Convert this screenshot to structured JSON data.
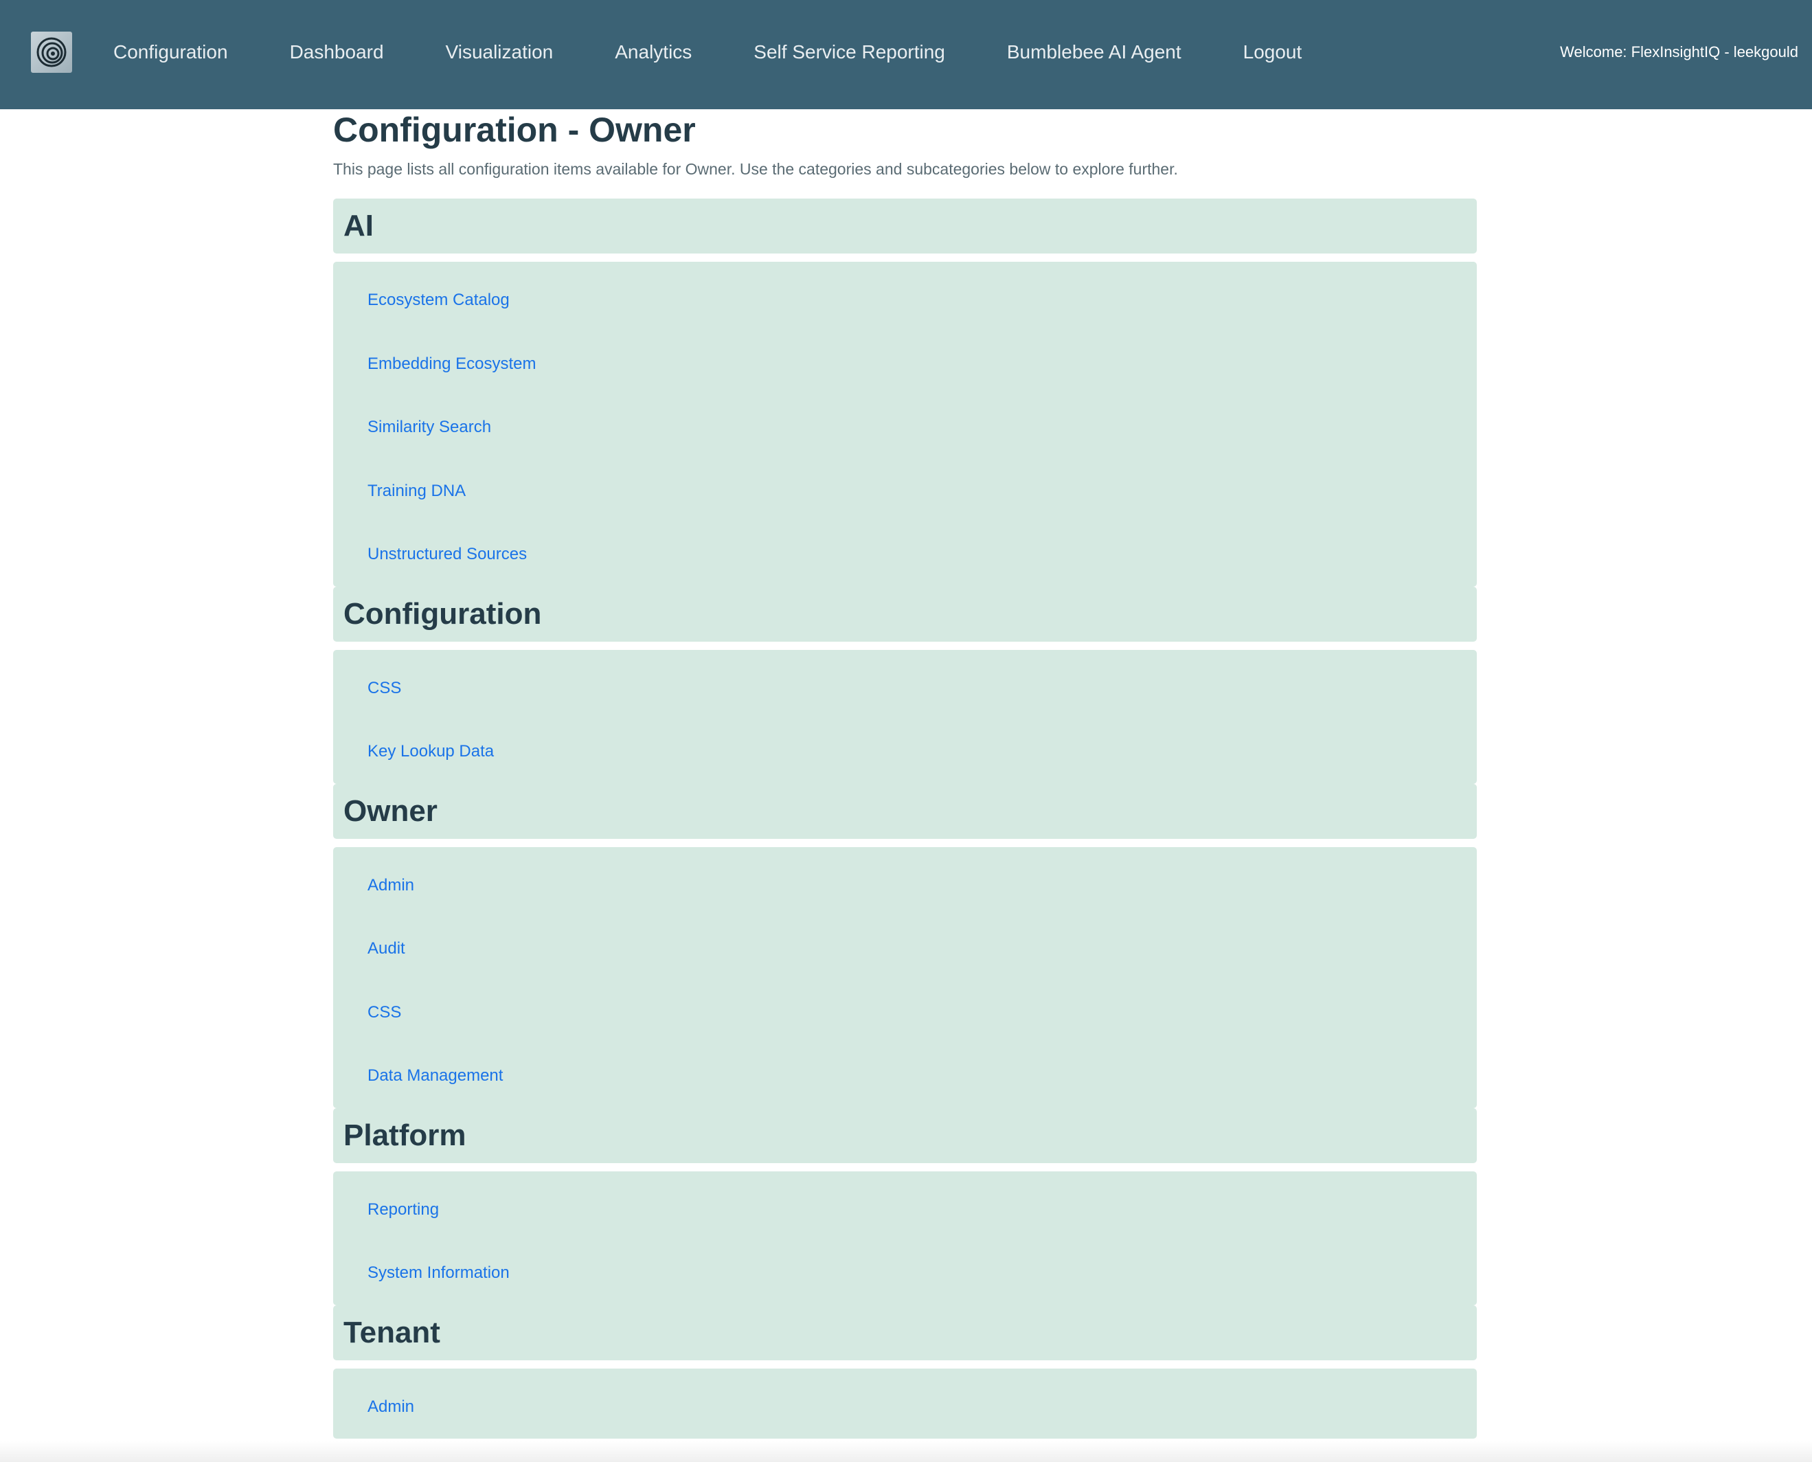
{
  "nav": {
    "links": [
      {
        "label": "Configuration"
      },
      {
        "label": "Dashboard"
      },
      {
        "label": "Visualization"
      },
      {
        "label": "Analytics"
      },
      {
        "label": "Self Service Reporting"
      },
      {
        "label": "Bumblebee AI Agent"
      },
      {
        "label": "Logout"
      }
    ],
    "welcome": "Welcome: FlexInsightIQ - leekgould",
    "logo_icon": "concentric-circles-logo-icon"
  },
  "page": {
    "title": "Configuration - Owner",
    "description": "This page lists all configuration items available for Owner. Use the categories and subcategories below to explore further."
  },
  "categories": [
    {
      "name": "AI",
      "items": [
        "Ecosystem Catalog",
        "Embedding Ecosystem",
        "Similarity Search",
        "Training DNA",
        "Unstructured Sources"
      ]
    },
    {
      "name": "Configuration",
      "items": [
        "CSS",
        "Key Lookup Data"
      ]
    },
    {
      "name": "Owner",
      "items": [
        "Admin",
        "Audit",
        "CSS",
        "Data Management"
      ]
    },
    {
      "name": "Platform",
      "items": [
        "Reporting",
        "System Information"
      ]
    },
    {
      "name": "Tenant",
      "items": [
        "Admin"
      ]
    }
  ],
  "colors": {
    "navbar": "#3b6275",
    "category_bg": "#d5e9e1",
    "link": "#1a73e8",
    "heading": "#253c48"
  }
}
